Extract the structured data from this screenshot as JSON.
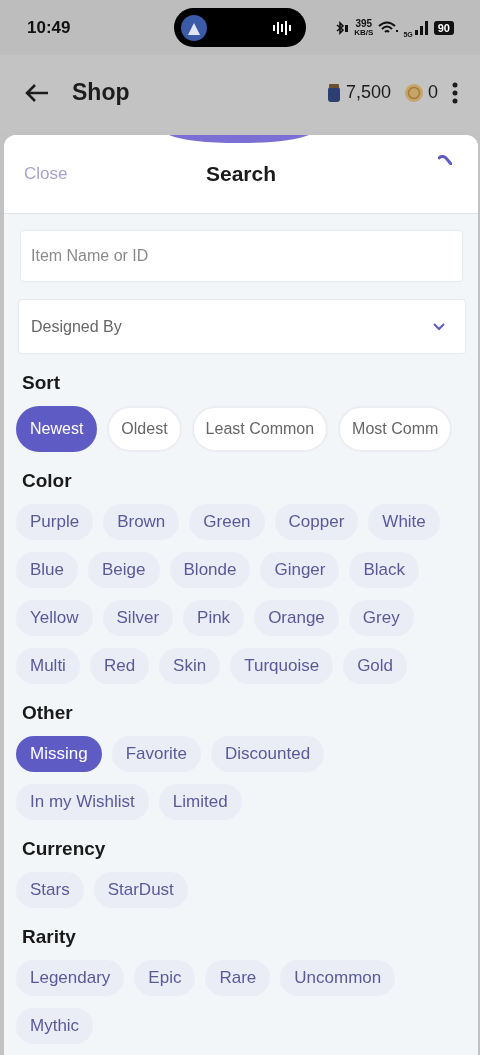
{
  "status_bar": {
    "time": "10:49",
    "speed": "395",
    "speed_unit": "KB/S",
    "network": "5G",
    "battery": "90"
  },
  "app_bar": {
    "title": "Shop",
    "balances": [
      {
        "kind": "gem",
        "amount": "7,500"
      },
      {
        "kind": "coin",
        "amount": "0"
      }
    ]
  },
  "sheet": {
    "close": "Close",
    "title": "Search",
    "search_field": {
      "placeholder": "Item Name or ID"
    },
    "designer_dropdown": {
      "placeholder": "Designed By"
    },
    "sections": [
      {
        "title": "Sort",
        "kind": "scroll",
        "options": [
          {
            "label": "Newest",
            "selected": true
          },
          {
            "label": "Oldest",
            "selected": false
          },
          {
            "label": "Least Common",
            "selected": false
          },
          {
            "label": "Most Comm",
            "selected": false
          }
        ]
      },
      {
        "title": "Color",
        "kind": "wrap",
        "options": [
          {
            "label": "Purple",
            "selected": false
          },
          {
            "label": "Brown",
            "selected": false
          },
          {
            "label": "Green",
            "selected": false
          },
          {
            "label": "Copper",
            "selected": false
          },
          {
            "label": "White",
            "selected": false
          },
          {
            "label": "Blue",
            "selected": false
          },
          {
            "label": "Beige",
            "selected": false
          },
          {
            "label": "Blonde",
            "selected": false
          },
          {
            "label": "Ginger",
            "selected": false
          },
          {
            "label": "Black",
            "selected": false
          },
          {
            "label": "Yellow",
            "selected": false
          },
          {
            "label": "Silver",
            "selected": false
          },
          {
            "label": "Pink",
            "selected": false
          },
          {
            "label": "Orange",
            "selected": false
          },
          {
            "label": "Grey",
            "selected": false
          },
          {
            "label": "Multi",
            "selected": false
          },
          {
            "label": "Red",
            "selected": false
          },
          {
            "label": "Skin",
            "selected": false
          },
          {
            "label": "Turquoise",
            "selected": false
          },
          {
            "label": "Gold",
            "selected": false
          }
        ]
      },
      {
        "title": "Other",
        "kind": "wrap",
        "options": [
          {
            "label": "Missing",
            "selected": true
          },
          {
            "label": "Favorite",
            "selected": false
          },
          {
            "label": "Discounted",
            "selected": false
          },
          {
            "label": "In my Wishlist",
            "selected": false
          },
          {
            "label": "Limited",
            "selected": false
          }
        ]
      },
      {
        "title": "Currency",
        "kind": "wrap",
        "options": [
          {
            "label": "Stars",
            "selected": false
          },
          {
            "label": "StarDust",
            "selected": false
          }
        ]
      },
      {
        "title": "Rarity",
        "kind": "wrap",
        "options": [
          {
            "label": "Legendary",
            "selected": false
          },
          {
            "label": "Epic",
            "selected": false
          },
          {
            "label": "Rare",
            "selected": false
          },
          {
            "label": "Uncommon",
            "selected": false
          },
          {
            "label": "Mythic",
            "selected": false
          }
        ]
      }
    ]
  }
}
